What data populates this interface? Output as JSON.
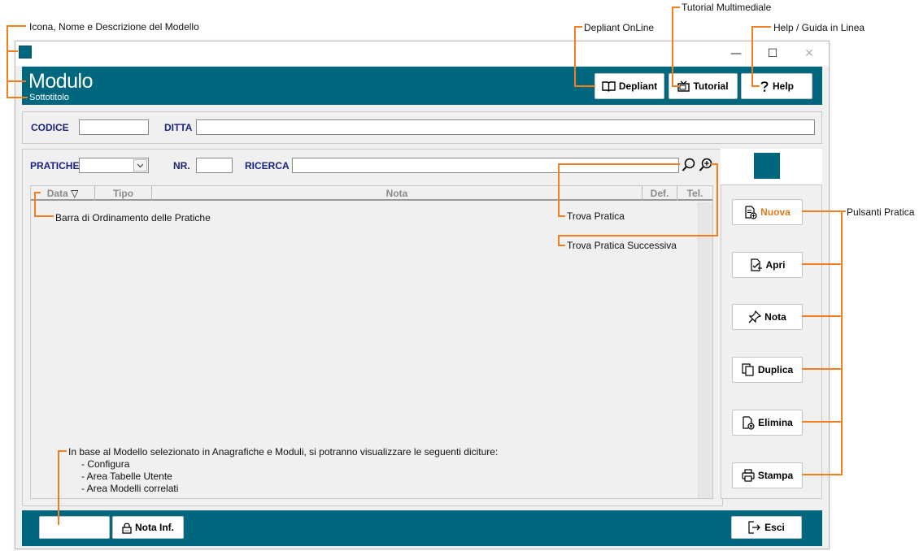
{
  "window": {
    "minimize_glyph": "—",
    "maximize_glyph": "☐",
    "close_glyph": "✕"
  },
  "header": {
    "title": "Modulo",
    "subtitle": "Sottotitolo",
    "buttons": {
      "depliant": "Depliant",
      "tutorial": "Tutorial",
      "help": "Help"
    }
  },
  "top_fields": {
    "codice_label": "CODICE",
    "ditta_label": "DITTA",
    "codice_value": "",
    "ditta_value": ""
  },
  "search": {
    "pratiche_label": "PRATICHE",
    "nr_label": "NR.",
    "ricerca_label": "RICERCA",
    "pratiche_value": "",
    "nr_value": "",
    "ricerca_value": ""
  },
  "table": {
    "columns": [
      "Data",
      "Tipo",
      "Nota",
      "Def.",
      "Tel."
    ],
    "sort_glyph": "▽"
  },
  "practice_buttons": [
    "Nuova",
    "Apri",
    "Nota",
    "Duplica",
    "Elimina",
    "Stampa"
  ],
  "footer": {
    "nota_inf": "Nota Inf.",
    "esci": "Esci"
  },
  "annotations": {
    "icona": "Icona, Nome e Descrizione del Modello",
    "depliant": "Depliant OnLine",
    "tutorial": "Tutorial Multimediale",
    "help": "Help / Guida in Linea",
    "barra": "Barra di Ordinamento delle Pratiche",
    "trova": "Trova Pratica",
    "trova_succ": "Trova Pratica Successiva",
    "pulsanti": "Pulsanti Pratica",
    "info_line1": "In base al Modello selezionato in Anagrafiche e Moduli, si potranno visualizzare le seguenti diciture:",
    "info_line2": "- Configura",
    "info_line3": "- Area Tabelle Utente",
    "info_line4": "- Area Modelli correlati"
  },
  "colors": {
    "accent": "#00677f",
    "annotation": "#f07f22",
    "label": "#1a237e",
    "nuova_label": "#e07a1f"
  }
}
